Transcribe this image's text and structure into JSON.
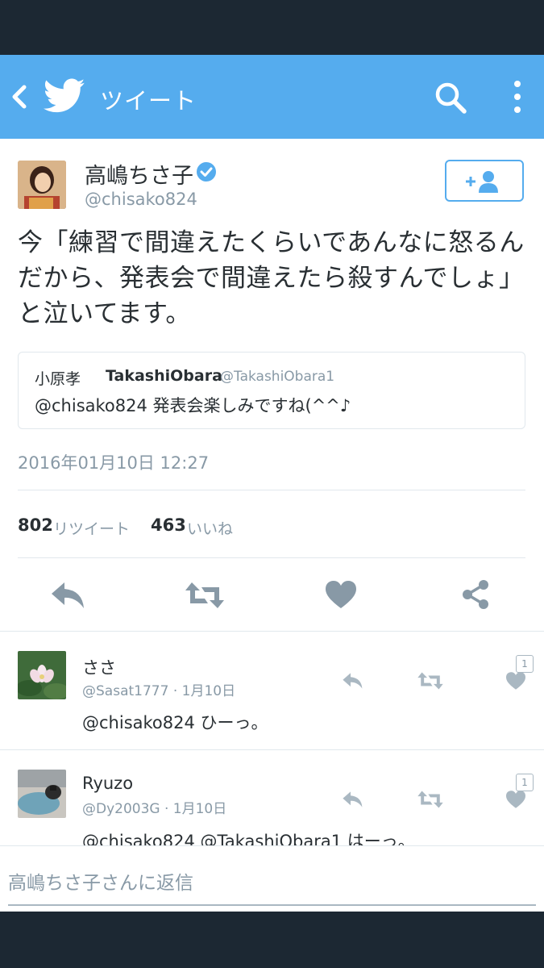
{
  "appbar": {
    "title": "ツイート",
    "color": "#55acee"
  },
  "tweet": {
    "author_name": "高嶋ちさ子",
    "author_handle": "@chisako824",
    "text": "今「練習で間違えたくらいであんなに怒るんだから、発表会で間違えたら殺すんでしょ」と泣いてます。",
    "quote": {
      "name": "小原孝",
      "screen_name": "TakashiObara",
      "handle": "@TakashiObara1",
      "text": "@chisako824 発表会楽しみですね(^^♪"
    },
    "timestamp": "2016年01月10日 12:27",
    "retweet_count": "802",
    "retweet_label": "リツイート",
    "like_count": "463",
    "like_label": "いいね"
  },
  "replies": [
    {
      "name": "ささ",
      "meta": "@Sasat1777 · 1月10日",
      "text": "@chisako824 ひーっ。",
      "like_count": "1"
    },
    {
      "name": "Ryuzo",
      "meta": "@Dy2003G · 1月10日",
      "text": "@chisako824 @TakashiObara1 はーっ。",
      "like_count": "1"
    }
  ],
  "reply_box": {
    "placeholder": "高嶋ちさ子さんに返信"
  },
  "icons": [
    "back-icon",
    "twitter-bird-icon",
    "search-icon",
    "more-vert-icon",
    "verified-icon",
    "follow-icon",
    "reply-icon",
    "retweet-icon",
    "like-icon",
    "share-icon"
  ]
}
